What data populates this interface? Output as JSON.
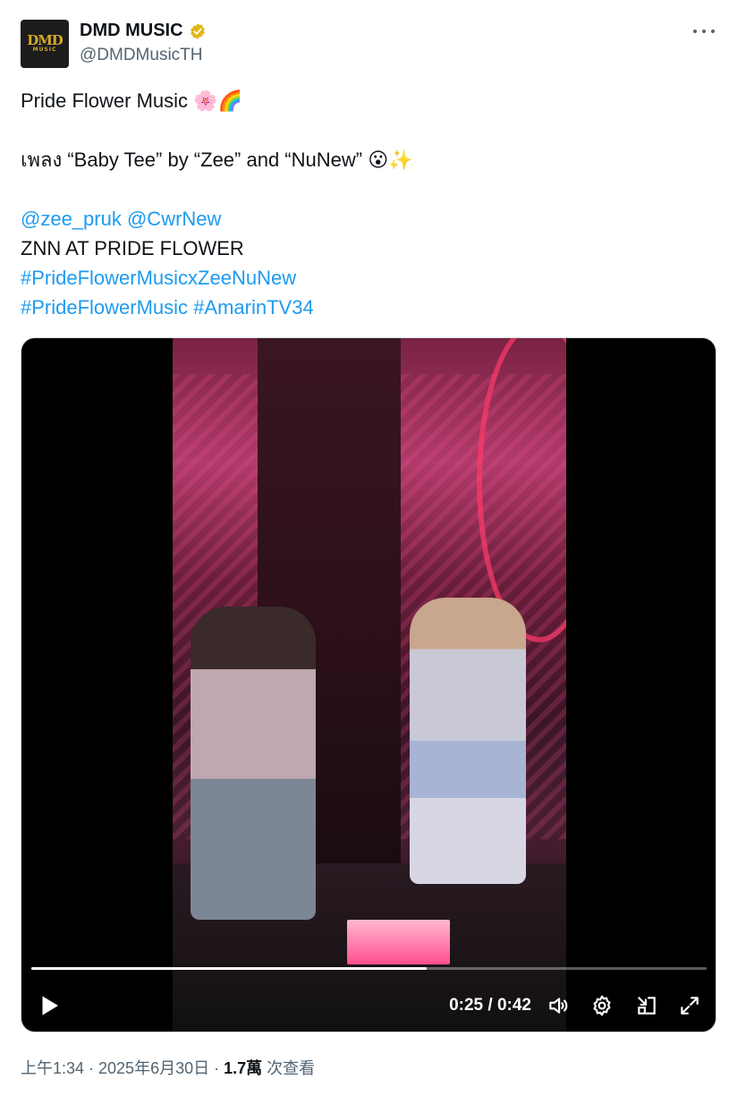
{
  "tweet": {
    "author": {
      "display_name": "DMD MUSIC",
      "handle": "@DMDMusicTH",
      "avatar_text_main": "DMD",
      "avatar_text_sub": "MUSIC",
      "verified_color": "#e2b719"
    },
    "lines": {
      "line1": "Pride Flower Music ",
      "line1_emoji": "🌸🌈",
      "line2": "เพลง “Baby Tee” by “Zee” and “NuNew” ",
      "line2_emoji": "😮✨",
      "mention1": "@zee_pruk",
      "mention2": "@CwrNew",
      "line4": "ZNN AT PRIDE FLOWER",
      "hashtag1": "#PrideFlowerMusicxZeeNuNew",
      "hashtag2": "#PrideFlowerMusic",
      "hashtag3": "#AmarinTV34"
    },
    "video": {
      "time_display": "0:25 / 0:42",
      "progress": 0.585
    },
    "meta": {
      "time_date": "上午1:34 · 2025年6月30日 · ",
      "views_count": "1.7萬",
      "views_label": " 次查看"
    }
  },
  "colors": {
    "link": "#1d9bf0",
    "text": "#0f1419",
    "secondary": "#536471"
  }
}
